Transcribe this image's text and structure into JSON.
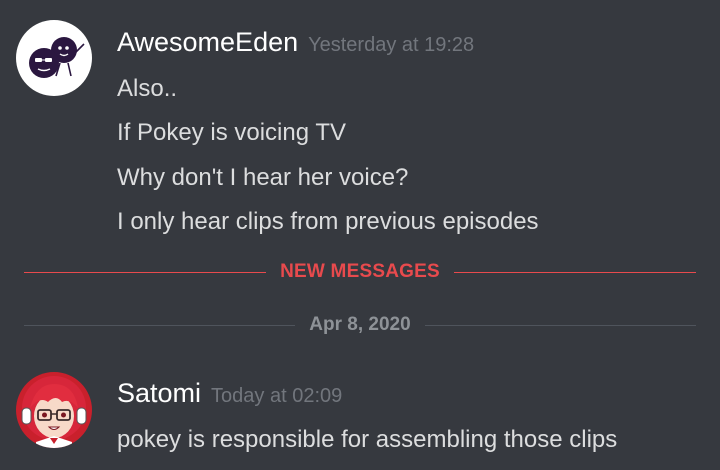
{
  "messages": [
    {
      "author": "AwesomeEden",
      "timestamp": "Yesterday at 19:28",
      "avatar_icon": "purple-blob-characters-avatar",
      "lines": [
        "Also..",
        "If Pokey is voicing TV",
        "Why don't I hear her voice?",
        "I only hear clips from previous episodes"
      ]
    },
    {
      "author": "Satomi",
      "timestamp": "Today at 02:09",
      "avatar_icon": "red-hair-anime-girl-avatar",
      "lines": [
        "pokey is responsible for assembling those clips"
      ]
    }
  ],
  "dividers": {
    "new_messages": "NEW MESSAGES",
    "date": "Apr 8, 2020"
  },
  "colors": {
    "background": "#36393f",
    "username": "#ffffff",
    "message_text": "#dcddde",
    "timestamp": "#72767d",
    "new_messages_accent": "#e84a4d",
    "date_divider_line": "#4f545c"
  }
}
